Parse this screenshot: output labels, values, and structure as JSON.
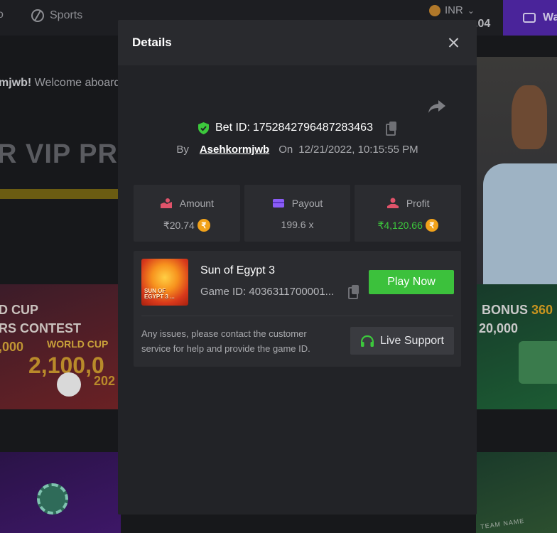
{
  "background": {
    "nav_partial": "o",
    "sports_label": "Sports",
    "currency": "INR",
    "balance_partial": ".04",
    "wallet_partial": "Wa",
    "welcome_user_partial": "mjwb!",
    "welcome_text": " Welcome aboard",
    "vip_partial": "R VIP PRO",
    "left_promo": {
      "line1": "D CUP",
      "line2": "RS CONTEST",
      "line3": ",000",
      "badge": "WORLD CUP",
      "amount_partial": "2,100,0",
      "year_partial": "202"
    },
    "right_promo": {
      "line1": "BONUS",
      "line1_value": "360",
      "line2": "20,000"
    },
    "team_name": "TEAM NAME"
  },
  "modal": {
    "title": "Details",
    "bet_id_label": "Bet ID:",
    "bet_id": "1752842796487283463",
    "by_label": "By",
    "username": "Asehkormjwb",
    "on_label": "On",
    "date": "12/21/2022, 10:15:55 PM",
    "stats": [
      {
        "label": "Amount",
        "value": "₹20.74",
        "icon": "amount-icon",
        "color": "#e0536a"
      },
      {
        "label": "Payout",
        "value": "199.6 x",
        "icon": "wallet-icon",
        "color": "#8a5cf6"
      },
      {
        "label": "Profit",
        "value": "₹4,120.66",
        "icon": "profit-icon",
        "color": "#e0536a"
      }
    ],
    "coin_symbol": "₹",
    "game": {
      "name": "Sun of Egypt 3",
      "id_label": "Game ID: 4036311700001...",
      "thumb_text_1": "SUN OF",
      "thumb_text_2": "EGYPT 3 ...",
      "play_label": "Play Now"
    },
    "support_text": "Any issues, please contact the customer service for help and provide the game ID.",
    "support_label": "Live Support"
  },
  "colors": {
    "accent_green": "#3cc13c",
    "profit_green": "#3cc83c",
    "coin_orange": "#f2a21a",
    "modal_bg": "#222327",
    "card_bg": "#2b2c30"
  }
}
